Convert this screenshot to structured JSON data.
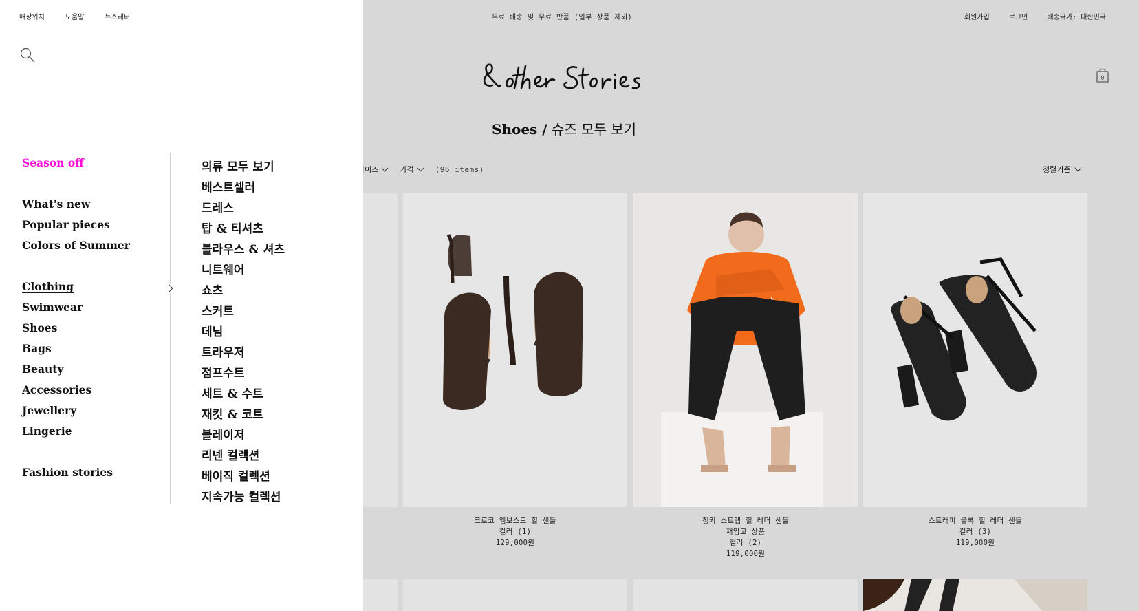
{
  "utility_nav": [
    "매장위치",
    "도움말",
    "뉴스레터"
  ],
  "promo_text": "무료 배송 및 무료 반품 (일부 상품 제외)",
  "account_nav": {
    "signup": "회원가입",
    "login": "로그인",
    "country": "배송국가: 대한민국"
  },
  "cart_count": "0",
  "page_title": {
    "category": "Shoes /",
    "label": "슈즈 모두 보기"
  },
  "filters": {
    "size": "사이즈",
    "price": "가격",
    "count": "(96 items)",
    "sort": "정렬기준"
  },
  "products": [
    {
      "name": "크로코 엠보스드 힐 샌들",
      "badge": "",
      "colors": "컬러 (1)",
      "price": "129,000원"
    },
    {
      "name": "청키 스트랩 힐 레더 샌들",
      "badge": "재입고 상품",
      "colors": "컬러 (2)",
      "price": "119,000원"
    },
    {
      "name": "스트래피 블록 힐 레더 샌들",
      "badge": "",
      "colors": "컬러 (3)",
      "price": "119,000원"
    }
  ],
  "menu": {
    "season": "Season off",
    "group1": [
      "What's new",
      "Popular pieces",
      "Colors of Summer"
    ],
    "group2": [
      "Clothing",
      "Swimwear",
      "Shoes",
      "Bags",
      "Beauty",
      "Accessories",
      "Jewellery",
      "Lingerie"
    ],
    "group3": [
      "Fashion stories"
    ],
    "sub": [
      "의류 모두 보기",
      "베스트셀러",
      "드레스",
      "탑 & 티셔츠",
      "블라우스 & 셔츠",
      "니트웨어",
      "쇼츠",
      "스커트",
      "데님",
      "트라우저",
      "점프수트",
      "세트 & 수트",
      "재킷 & 코트",
      "블레이저",
      "리넨 컬렉션",
      "베이직 컬렉션",
      "지속가능 컬렉션"
    ]
  },
  "colors": {
    "season_accent": "#ff0ad8",
    "overlay_bg": "#d8d8d8"
  },
  "icons": [
    "search-icon",
    "shopping-bag-icon",
    "chevron-down-icon",
    "chevron-right-icon"
  ]
}
